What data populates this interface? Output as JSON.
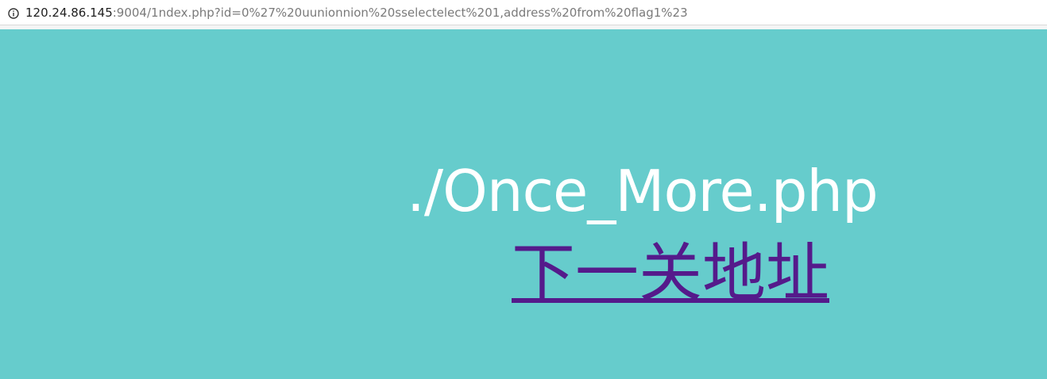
{
  "address_bar": {
    "url_host": "120.24.86.145",
    "url_rest": ":9004/1ndex.php?id=0%27%20uunionnion%20sselectelect%201,address%20from%20flag1%23",
    "icon": "info-icon"
  },
  "page": {
    "background": "#66cccc",
    "main_text": "./Once_More.php",
    "next_link_label": "下一关地址",
    "link_color": "#551a8b"
  }
}
